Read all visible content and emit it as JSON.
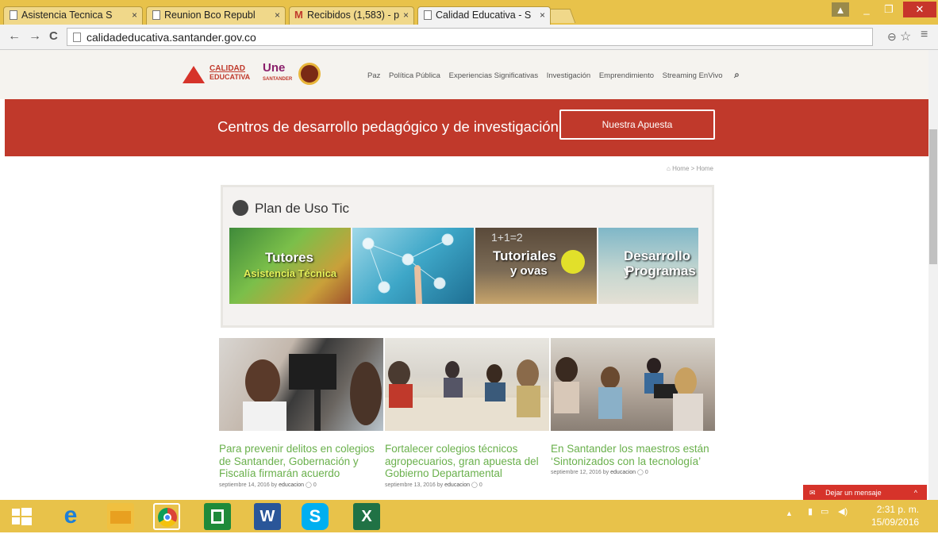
{
  "browser": {
    "tabs": [
      {
        "title": "Asistencia Tecnica S",
        "icon": "page-icon"
      },
      {
        "title": "Reunion Bco Republ",
        "icon": "page-icon"
      },
      {
        "title": "Recibidos (1,583) - p",
        "icon": "gmail-icon"
      },
      {
        "title": "Calidad Educativa - S",
        "icon": "page-icon",
        "active": true
      }
    ],
    "tab_close": "×",
    "url": "calidadeducativa.santander.gov.co",
    "nav_back": "←",
    "nav_forward": "→",
    "nav_reload": "C",
    "zoom_icon": "⊖",
    "star_icon": "☆",
    "menu_icon": "≡",
    "win_min": "_",
    "win_restore": "❐",
    "win_close": "✕"
  },
  "site": {
    "logo_text_1": "CALIDAD",
    "logo_text_2": "EDUCATIVA",
    "logo_une": "Une",
    "logo_santander": "SANTANDER",
    "menu": [
      "Paz",
      "Política Pública",
      "Experiencias Significativas",
      "Investigación",
      "Emprendimiento",
      "Streaming EnVivo"
    ],
    "search_icon": "⌕",
    "banner_title": "Centros de desarrollo pedagógico y de investigación",
    "banner_button": "Nuestra Apuesta",
    "breadcrumb_home": "Home",
    "breadcrumb_sep": ">",
    "breadcrumb_current": "Home",
    "section_title": "Plan de Uso Tic",
    "tiles": [
      {
        "line1": "Tutores",
        "line2": "Asistencia Técnica"
      },
      {
        "line1": "",
        "line2": ""
      },
      {
        "line1": "Tutoriales",
        "line2": "y ovas"
      },
      {
        "line1": "Desarrollo y",
        "line2": "Programas"
      }
    ],
    "news": [
      {
        "title": "Para prevenir delitos en colegios de Santander, Gobernación y Fiscalía firmarán acuerdo",
        "date": "septiembre 14, 2016",
        "by": "by",
        "author": "educacion",
        "comments": "0"
      },
      {
        "title": "Fortalecer colegios técnicos agropecuarios, gran apuesta del Gobierno Departamental",
        "date": "septiembre 13, 2016",
        "by": "by",
        "author": "educacion",
        "comments": "0"
      },
      {
        "title": "En Santander los maestros están ‘Sintonizados con la tecnología’",
        "date": "septiembre 12, 2016",
        "by": "by",
        "author": "educacion",
        "comments": "0"
      }
    ],
    "chat_label": "Dejar un mensaje",
    "chat_caret": "^"
  },
  "taskbar": {
    "time": "2:31 p. m.",
    "date": "15/09/2016"
  },
  "colors": {
    "banner": "#c0392b",
    "news_title": "#6ab04c",
    "taskbar": "#e8c24a"
  }
}
